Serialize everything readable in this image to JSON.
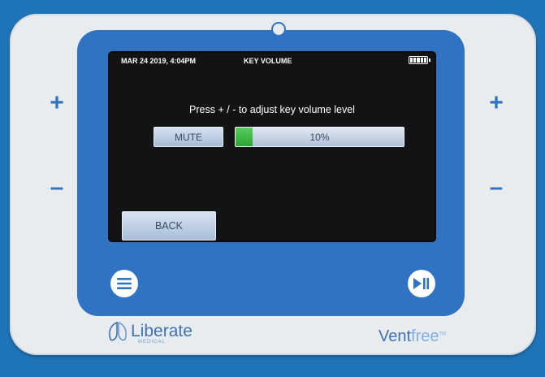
{
  "status": {
    "datetime": "MAR 24 2019, 4:04PM",
    "screen_title": "KEY VOLUME"
  },
  "instruction": "Press + / - to adjust key volume level",
  "buttons": {
    "mute": "MUTE",
    "back": "BACK"
  },
  "volume": {
    "label": "10%",
    "level": 0.1
  },
  "hardware": {
    "plus": "+",
    "minus": "–"
  },
  "branding": {
    "left_name": "Liberate",
    "left_sub": "MEDICAL",
    "right_name_a": "Vent",
    "right_name_b": "free",
    "right_mark": "TM"
  },
  "colors": {
    "frame_blue": "#2f73c2",
    "volume_fill": "#3fb84a"
  }
}
